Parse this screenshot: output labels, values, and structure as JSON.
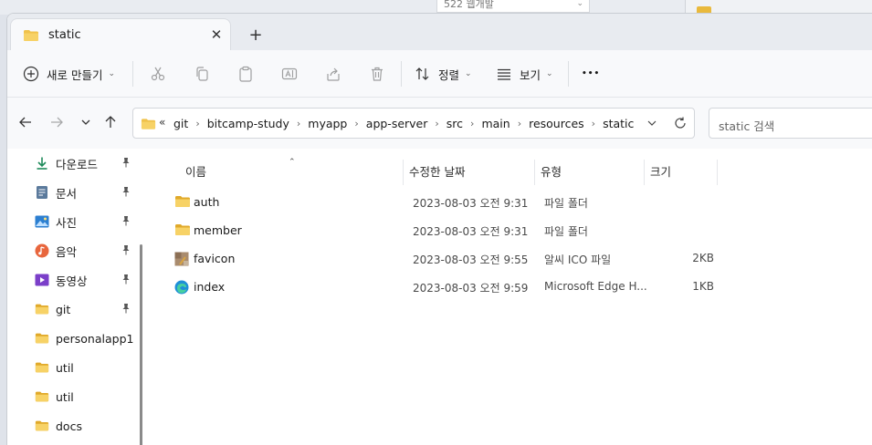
{
  "background": {
    "dropdown_text": "522 웹개발"
  },
  "tab": {
    "title": "static",
    "close_glyph": "✕",
    "new_tab_glyph": "+"
  },
  "commandbar": {
    "new_label": "새로 만들기",
    "sort_label": "정렬",
    "view_label": "보기",
    "more_glyph": "•••"
  },
  "address": {
    "overflow_glyph": "«",
    "crumbs": [
      "git",
      "bitcamp-study",
      "myapp",
      "app-server",
      "src",
      "main",
      "resources",
      "static"
    ],
    "separator": "›",
    "search_placeholder": "static 검색"
  },
  "navpane": {
    "items": [
      {
        "label": "다운로드",
        "icon": "download-icon",
        "pinned": true
      },
      {
        "label": "문서",
        "icon": "document-icon",
        "pinned": true
      },
      {
        "label": "사진",
        "icon": "picture-icon",
        "pinned": true
      },
      {
        "label": "음악",
        "icon": "music-icon",
        "pinned": true
      },
      {
        "label": "동영상",
        "icon": "video-icon",
        "pinned": true
      },
      {
        "label": "git",
        "icon": "folder-icon",
        "pinned": true
      },
      {
        "label": "personalapp1",
        "icon": "folder-icon",
        "pinned": false
      },
      {
        "label": "util",
        "icon": "folder-icon",
        "pinned": false
      },
      {
        "label": "util",
        "icon": "folder-icon",
        "pinned": false
      },
      {
        "label": "docs",
        "icon": "folder-icon",
        "pinned": false
      }
    ]
  },
  "columns": {
    "name": "이름",
    "date": "수정한 날짜",
    "type": "유형",
    "size": "크기"
  },
  "files": [
    {
      "name": "auth",
      "date": "2023-08-03 오전 9:31",
      "type": "파일 폴더",
      "size": "",
      "icon": "folder-icon"
    },
    {
      "name": "member",
      "date": "2023-08-03 오전 9:31",
      "type": "파일 폴더",
      "size": "",
      "icon": "folder-icon"
    },
    {
      "name": "favicon",
      "date": "2023-08-03 오전 9:55",
      "type": "알씨 ICO 파일",
      "size": "2KB",
      "icon": "image-file-icon"
    },
    {
      "name": "index",
      "date": "2023-08-03 오전 9:59",
      "type": "Microsoft Edge H...",
      "size": "1KB",
      "icon": "edge-icon"
    }
  ],
  "colors": {
    "folder": "#f0c24b",
    "folder_dark": "#e0a92a",
    "accent": "#0067c0",
    "chrome": "#e8ebf0"
  }
}
